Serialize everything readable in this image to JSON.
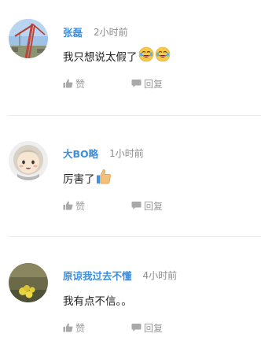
{
  "comments": [
    {
      "username": "张磊",
      "time": "2小时前",
      "text": "我只想说太假了",
      "emojis": [
        "tears-of-joy-emoji",
        "tears-of-joy-emoji"
      ],
      "like_label": "赞",
      "reply_label": "回复"
    },
    {
      "username": "大BO略",
      "time": "1小时前",
      "text": "厉害了",
      "emojis": [
        "thumbs-up-emoji"
      ],
      "like_label": "赞",
      "reply_label": "回复"
    },
    {
      "username": "原谅我过去不懂",
      "time": "4小时前",
      "text": "我有点不信。。",
      "emojis": [],
      "like_label": "赞",
      "reply_label": "回复"
    }
  ],
  "colors": {
    "username": "#3d8fe0",
    "time": "#8c8c8c",
    "action": "#999999",
    "divider": "#ececec"
  }
}
